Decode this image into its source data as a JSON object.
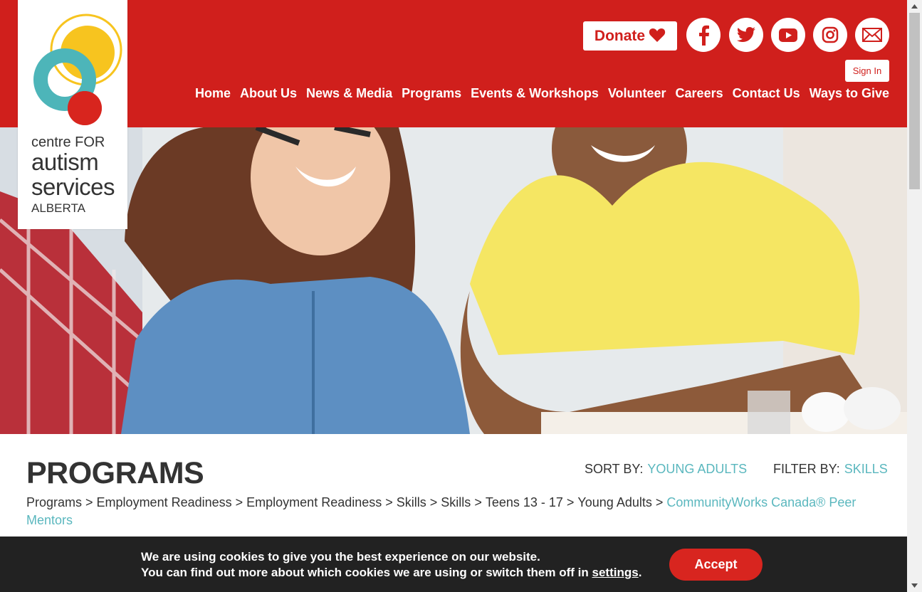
{
  "brand": {
    "line1": "centre FOR",
    "line2": "autism",
    "line3": "services",
    "line4": "ALBERTA"
  },
  "header": {
    "donate_label": "Donate",
    "signin_label": "Sign In",
    "nav": [
      "Home",
      "About Us",
      "News & Media",
      "Programs",
      "Events & Workshops",
      "Volunteer",
      "Careers",
      "Contact Us",
      "Ways to Give"
    ],
    "social_icons": [
      "facebook-icon",
      "twitter-icon",
      "youtube-icon",
      "instagram-icon",
      "email-icon"
    ]
  },
  "main": {
    "title": "PROGRAMS",
    "sort_label": "SORT BY:",
    "sort_value": "YOUNG ADULTS",
    "filter_label": "FILTER BY:",
    "filter_value": "SKILLS",
    "breadcrumb": [
      "Programs",
      "Employment Readiness",
      "Employment Readiness",
      "Skills",
      "Skills",
      "Teens 13 - 17",
      "Young Adults"
    ],
    "breadcrumb_sep": ">",
    "breadcrumb_current": "CommunityWorks Canada® Peer Mentors"
  },
  "cookie": {
    "line1": "We are using cookies to give you the best experience on our website.",
    "line2_prefix": "You can find out more about which cookies we are using or switch them off in",
    "settings_link": "settings",
    "line2_suffix": ".",
    "accept_label": "Accept"
  },
  "colors": {
    "brand_red": "#d01f1c",
    "accent_teal": "#5ab7be",
    "cookie_bg": "#222222"
  }
}
